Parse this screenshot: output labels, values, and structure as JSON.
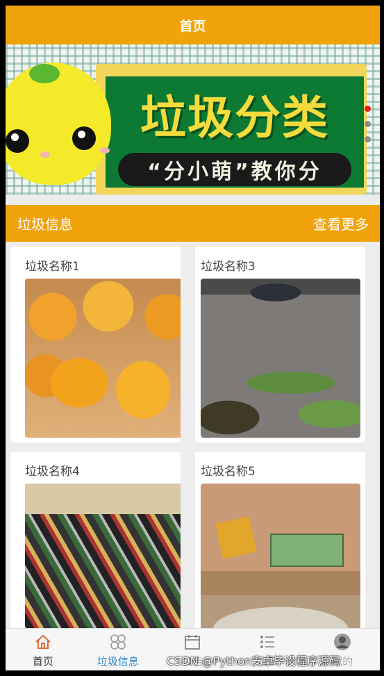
{
  "header": {
    "title": "首页"
  },
  "banner": {
    "title": "垃圾分类",
    "subtitle": "“分小萌”教你分",
    "active_dot_index": 0,
    "dot_count": 3
  },
  "section": {
    "title": "垃圾信息",
    "more_label": "查看更多"
  },
  "cards": [
    {
      "name": "垃圾名称1"
    },
    {
      "name": "垃圾名称3"
    },
    {
      "name": "垃圾名称4"
    },
    {
      "name": "垃圾名称5"
    }
  ],
  "tabbar": {
    "items": [
      {
        "label": "首页"
      },
      {
        "label": "垃圾信息"
      },
      {
        "label": "公告"
      },
      {
        "label": "论坛"
      },
      {
        "label": "我的"
      }
    ]
  },
  "watermark": "CSDN @Python安卓毕设程序源码",
  "colors": {
    "accent": "#f0a30a",
    "active_dot": "#e01c1c",
    "link_blue": "#2b87c9"
  }
}
